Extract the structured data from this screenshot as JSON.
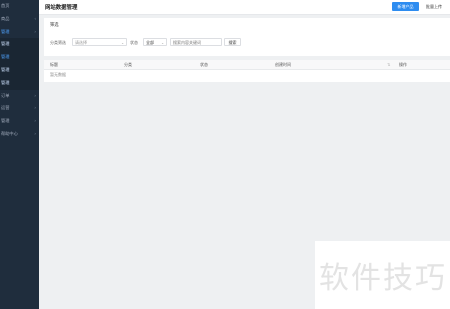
{
  "sidebar": {
    "items": [
      {
        "label": "首页",
        "chevron": ""
      },
      {
        "label": "商品",
        "chevron": "‹"
      },
      {
        "label": "管理",
        "chevron": "›"
      },
      {
        "label": "管理",
        "chevron": ""
      },
      {
        "label": "管理",
        "chevron": ""
      },
      {
        "label": "管理",
        "chevron": ""
      },
      {
        "label": "管理",
        "chevron": ""
      },
      {
        "label": "订单",
        "chevron": "›"
      },
      {
        "label": "运营",
        "chevron": "›"
      },
      {
        "label": "管理",
        "chevron": "›"
      },
      {
        "label": "帮助中心",
        "chevron": "›"
      }
    ]
  },
  "header": {
    "title": "网站数据管理",
    "primary_button": "新增产品",
    "secondary_button": "批量上传"
  },
  "filter": {
    "title": "筛选",
    "category_label": "分类筛选",
    "category_placeholder": "请选择",
    "status_label": "状态",
    "status_value": "全部",
    "keyword_placeholder": "搜索内容关键词",
    "search_button": "搜索"
  },
  "table": {
    "columns": [
      "标题",
      "分类",
      "状态",
      "创建时间",
      "操作"
    ],
    "empty_text": "暂无数据"
  },
  "watermark": {
    "text": "软件技巧"
  }
}
